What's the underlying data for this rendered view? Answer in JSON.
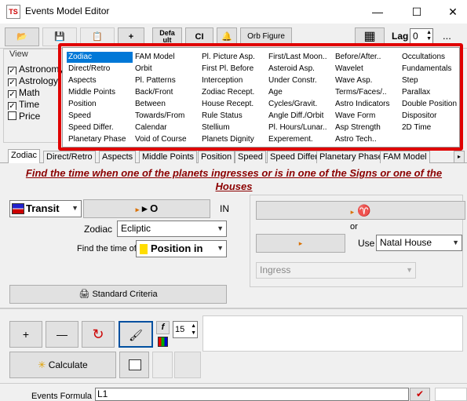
{
  "window": {
    "title": "Events Model Editor",
    "app_icon_text": "TS",
    "minimize_glyph": "—",
    "maximize_glyph": "☐",
    "close_glyph": "✕"
  },
  "toolbar": {
    "open_glyph": "📂",
    "save_glyph": "💾",
    "saveas_glyph": "📋",
    "add_label": "+",
    "default_label": "Defa\nult",
    "ci_label": "CI",
    "bell_glyph": "🔔",
    "orb_label": "Orb Figure",
    "grid_glyph": "▦",
    "lag_label": "Lag",
    "lag_value": "0",
    "more_label": "..."
  },
  "view": {
    "title": "View",
    "items": [
      {
        "label": "Astronomy",
        "checked": true
      },
      {
        "label": "Astrology",
        "checked": true
      },
      {
        "label": "Math",
        "checked": true
      },
      {
        "label": "Time",
        "checked": true
      },
      {
        "label": "Price",
        "checked": false
      }
    ]
  },
  "event_list": {
    "columns": [
      [
        "Zodiac",
        "Direct/Retro",
        "Aspects",
        "Middle Points",
        "Position",
        "Speed",
        "Speed Differ.",
        "Planetary Phase"
      ],
      [
        "FAM Model",
        "Orbit",
        "Pl. Patterns",
        "Back/Front",
        "Between",
        "Towards/From",
        "Calendar",
        "Void of Course"
      ],
      [
        "Pl. Picture Asp.",
        "First Pl. Before",
        "Interception",
        "Zodiac Recept.",
        "House Recept.",
        "Rule Status",
        "Stellium",
        "Planets Dignity"
      ],
      [
        "First/Last Moon..",
        "Asteroid Asp.",
        "Under Constr.",
        "Age",
        "Cycles/Gravit.",
        "Angle Diff./Orbit",
        "Pl. Hours/Lunar..",
        "Experement."
      ],
      [
        "Before/After..",
        "Wavelet",
        "Wave Asp.",
        "Terms/Faces/..",
        "Astro Indicators",
        "Wave Form",
        "Asp Strength",
        "Astro Tech.."
      ],
      [
        "Occultations",
        "Fundamentals",
        "Step",
        "Parallax",
        "Double Position",
        "Dispositor",
        "2D Time",
        ""
      ]
    ],
    "selected": "Zodiac"
  },
  "tabs": [
    "Zodiac",
    "Direct/Retro",
    "Aspects",
    "Middle Points",
    "Position",
    "Speed",
    "Speed Differ.",
    "Planetary Phase",
    "FAM Model"
  ],
  "tab_scroll_glyph": "▸",
  "heading": "Find the time when one of the planets ingresses or is in one of the Signs or one of the Houses",
  "form": {
    "transit_value": "Transit",
    "planet_button": "▸ O",
    "in_label": "IN",
    "zodiac_label": "Zodiac",
    "zodiac_value": "Ecliptic",
    "find_label": "Find the time of",
    "find_value": "Position in",
    "sign_button": "▸ ♈",
    "or_label": "or",
    "house_button": "▸",
    "use_label": "Use",
    "use_value": "Natal House",
    "ingress_value": "Ingress",
    "standard_label": "Standard Criteria",
    "standard_icon": "🖨"
  },
  "bottom": {
    "plus_label": "+",
    "minus_label": "—",
    "refresh_glyph": "↻",
    "brush_glyph": "🖌",
    "f_label": "f",
    "size_value": "15",
    "calculate_label": "Calculate",
    "calc_glyph": "✳",
    "formula_label": "Events Formula",
    "formula_value": "L1"
  },
  "colors": {
    "selection": "#0078d7",
    "heading": "#8b0000",
    "highlight": "#e00000",
    "sun_red": "#cc3300"
  }
}
